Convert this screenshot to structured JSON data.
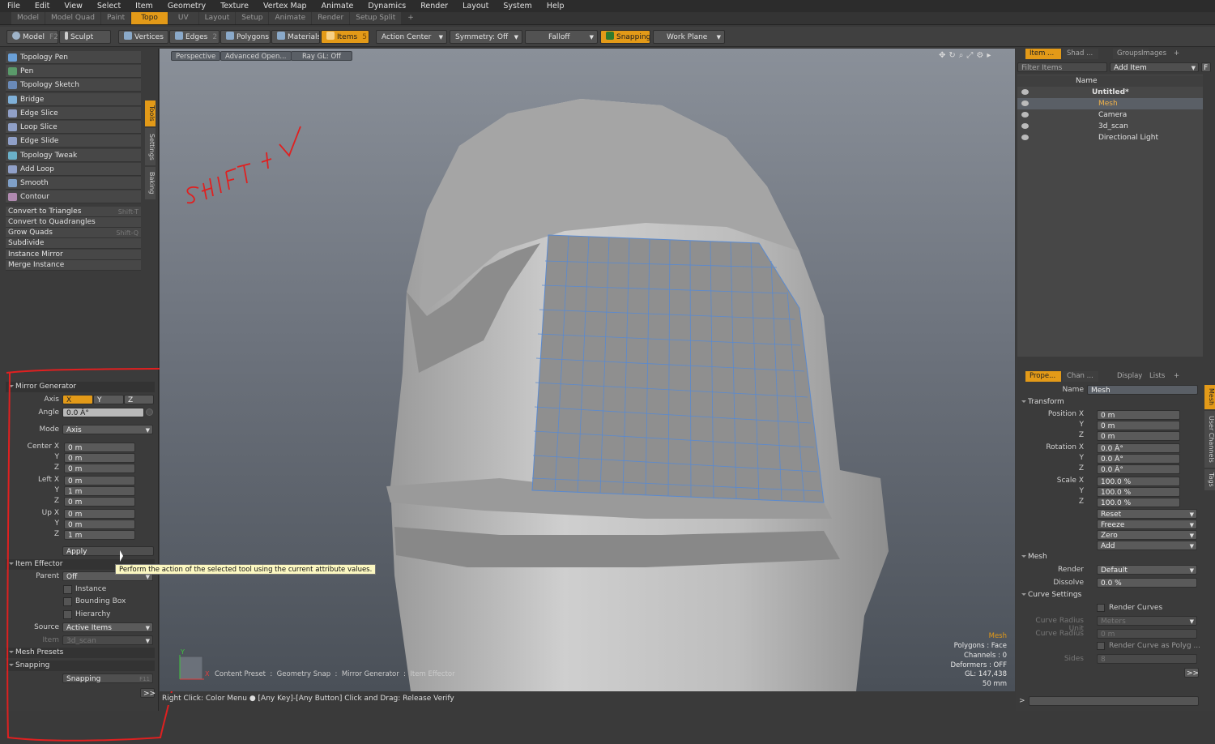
{
  "menu": [
    "File",
    "Edit",
    "View",
    "Select",
    "Item",
    "Geometry",
    "Texture",
    "Vertex Map",
    "Animate",
    "Dynamics",
    "Render",
    "Layout",
    "System",
    "Help"
  ],
  "layouts": [
    "Model",
    "Model Quad",
    "Paint",
    "Topo",
    "UV",
    "Layout",
    "Setup",
    "Animate",
    "Render",
    "Setup Split",
    "+"
  ],
  "active_layout": "Topo",
  "toolbar": {
    "model": "Model",
    "model_key": "F2",
    "sculpt": "Sculpt",
    "vertices": "Vertices",
    "edges": "Edges",
    "edges_key": "2",
    "polygons": "Polygons",
    "materials": "Materials",
    "items": "Items",
    "items_key": "5",
    "action_center": "Action Center",
    "symmetry": "Symmetry: Off",
    "falloff": "Falloff",
    "snapping": "Snapping",
    "work_plane": "Work Plane"
  },
  "tools": [
    "Topology Pen",
    "Pen",
    "Topology Sketch",
    "Bridge",
    "Edge Slice",
    "Loop Slice",
    "Edge Slide",
    "Topology Tweak",
    "Add Loop",
    "Smooth",
    "Contour"
  ],
  "commands1": [
    {
      "label": "Convert to Triangles",
      "key": "Shift-T"
    },
    {
      "label": "Convert to Quadrangles",
      "key": ""
    },
    {
      "label": "Grow Quads",
      "key": "Shift-Q"
    },
    {
      "label": "Subdivide",
      "key": ""
    }
  ],
  "commands2": [
    "Instance Mirror",
    "Merge Instance"
  ],
  "side_tabs": [
    "Tools",
    "Settings",
    "Baking"
  ],
  "mirror": {
    "title": "Mirror Generator",
    "axis_label": "Axis",
    "axes": [
      "X",
      "Y",
      "Z"
    ],
    "angle_label": "Angle",
    "angle": "0.0 Â°",
    "mode_label": "Mode",
    "mode": "Axis",
    "center_label": "Center X",
    "center": [
      "0 m",
      "0 m",
      "0 m"
    ],
    "left_label": "Left X",
    "left": [
      "0 m",
      "1 m",
      "0 m"
    ],
    "up_label": "Up X",
    "up": [
      "0 m",
      "0 m",
      "1 m"
    ],
    "y_label": "Y",
    "z_label": "Z",
    "apply": "Apply"
  },
  "effector": {
    "title": "Item Effector",
    "parent_label": "Parent",
    "parent": "Off",
    "instance": "Instance",
    "bounding_box": "Bounding Box",
    "hierarchy": "Hierarchy",
    "source_label": "Source",
    "source": "Active Items",
    "item_label": "Item",
    "item": "3d_scan"
  },
  "mesh_presets": "Mesh Presets",
  "snapping_section": "Snapping",
  "snapping_btn": "Snapping",
  "snapping_key": "F11",
  "expand": ">>",
  "tooltip": "Perform the action of the selected tool using the current attribute values.",
  "viewport": {
    "buttons": [
      "Perspective",
      "Advanced Open...",
      "Ray GL: Off"
    ],
    "annotation": "SHIFT + V",
    "info": [
      "Mesh",
      "Polygons : Face",
      "Channels : 0",
      "Deformers : OFF",
      "GL: 147,438",
      "50 mm"
    ],
    "breadcrumb": "Content Preset  :  Geometry Snap  :  Mirror Generator  :  Item Effector"
  },
  "statusbar": "Right Click: Color Menu  ●   [Any Key]-[Any Button] Click and Drag: Release Verify",
  "items_panel": {
    "tabs": [
      "Item ...",
      "Shad ...",
      "Groups",
      "Images",
      "+"
    ],
    "filter": "Filter Items",
    "add_item": "Add Item",
    "f": "F",
    "name_col": "Name",
    "tree": [
      "Untitled*",
      "Mesh",
      "Camera",
      "3d_scan",
      "Directional Light"
    ]
  },
  "props_panel": {
    "tabs": [
      "Prope...",
      "Chan ...",
      "Display",
      "Lists",
      "+"
    ],
    "side_tabs": [
      "Mesh",
      "User Channels",
      "Tags"
    ],
    "name_label": "Name",
    "name": "Mesh",
    "transform": "Transform",
    "position_label": "Position X",
    "position": [
      "0 m",
      "0 m",
      "0 m"
    ],
    "rotation_label": "Rotation X",
    "rotation": [
      "0.0 Â°",
      "0.0 Â°",
      "0.0 Â°"
    ],
    "scale_label": "Scale X",
    "scale": [
      "100.0 %",
      "100.0 %",
      "100.0 %"
    ],
    "y_label": "Y",
    "z_label": "Z",
    "actions": [
      "Reset",
      "Freeze",
      "Zero",
      "Add"
    ],
    "mesh_section": "Mesh",
    "render_label": "Render",
    "render": "Default",
    "dissolve_label": "Dissolve",
    "dissolve": "0.0 %",
    "curve_section": "Curve Settings",
    "render_curves": "Render Curves",
    "curve_radius_unit_label": "Curve Radius Unit",
    "curve_radius_unit": "Meters",
    "curve_radius_label": "Curve Radius",
    "curve_radius": "0 m",
    "render_curve_poly": "Render Curve as Polyg ...",
    "sides_label": "Sides",
    "sides": "8",
    "expand": ">>",
    "cmd_prompt": ">"
  },
  "colors": {
    "accent": "#e39a18",
    "annotation": "#e02020",
    "wire": "#5a8ad0"
  }
}
